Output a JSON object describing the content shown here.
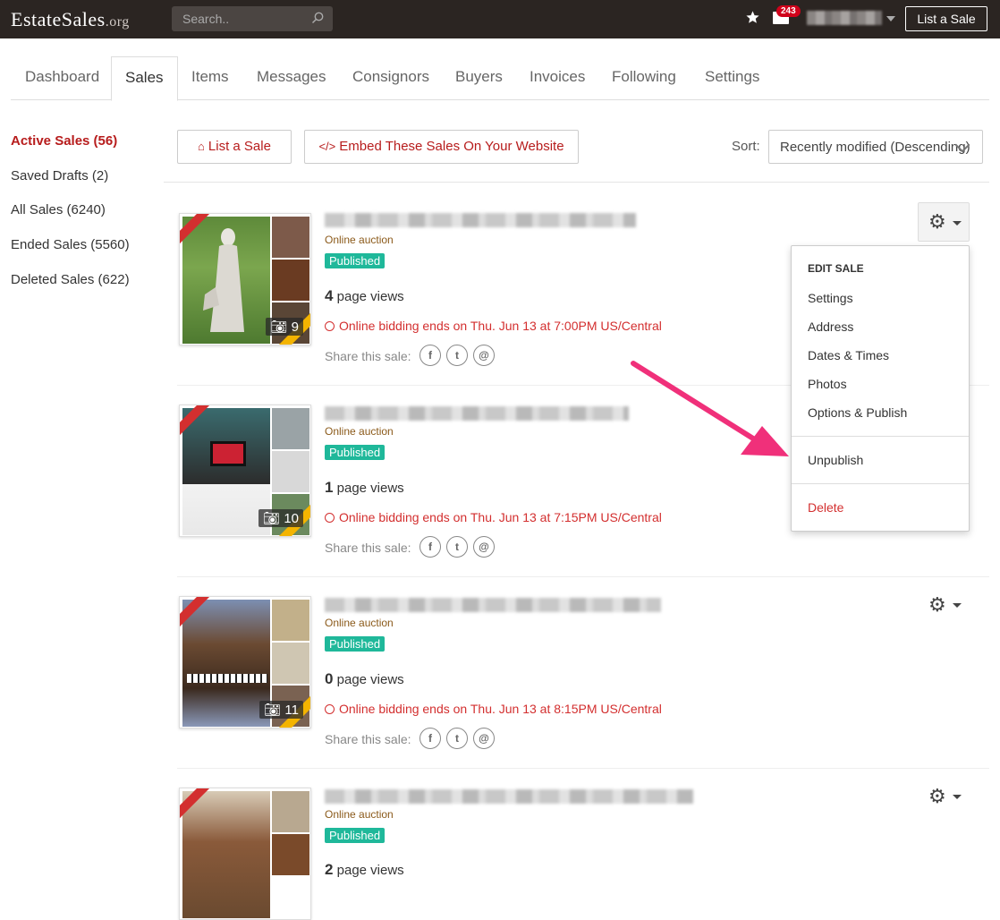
{
  "topbar": {
    "logo_main": "EstateSales",
    "logo_suffix": ".org",
    "search_placeholder": "Search..",
    "mail_count": "243",
    "list_sale_label": "List a Sale"
  },
  "tabs": [
    "Dashboard",
    "Sales",
    "Items",
    "Messages",
    "Consignors",
    "Buyers",
    "Invoices",
    "Following",
    "Settings"
  ],
  "sidenav": [
    "Active Sales (56)",
    "Saved Drafts (2)",
    "All Sales (6240)",
    "Ended Sales (5560)",
    "Deleted Sales (622)"
  ],
  "toolbar": {
    "list_sale": "List a Sale",
    "embed": "Embed These Sales On Your Website",
    "sort_label": "Sort:",
    "sort_value": "Recently modified (Descending)"
  },
  "cards": [
    {
      "type": "Online auction",
      "status": "Published",
      "views_num": "4",
      "views_label": "page views",
      "ends": "Online bidding ends on Thu. Jun 13 at 7:00PM US/Central",
      "share": "Share this sale:",
      "photos": "9"
    },
    {
      "type": "Online auction",
      "status": "Published",
      "views_num": "1",
      "views_label": "page views",
      "ends": "Online bidding ends on Thu. Jun 13 at 7:15PM US/Central",
      "share": "Share this sale:",
      "photos": "10"
    },
    {
      "type": "Online auction",
      "status": "Published",
      "views_num": "0",
      "views_label": "page views",
      "ends": "Online bidding ends on Thu. Jun 13 at 8:15PM US/Central",
      "share": "Share this sale:",
      "photos": "11"
    },
    {
      "type": "Online auction",
      "status": "Published",
      "views_num": "2",
      "views_label": "page views"
    }
  ],
  "menu": {
    "header": "EDIT SALE",
    "items": [
      "Settings",
      "Address",
      "Dates & Times",
      "Photos",
      "Options & Publish"
    ],
    "unpublish": "Unpublish",
    "delete": "Delete"
  },
  "colors": {
    "accent_red": "#b71c1c",
    "published_green": "#1fb89a",
    "arrow_pink": "#f0307a",
    "topbar": "#2b2522"
  }
}
